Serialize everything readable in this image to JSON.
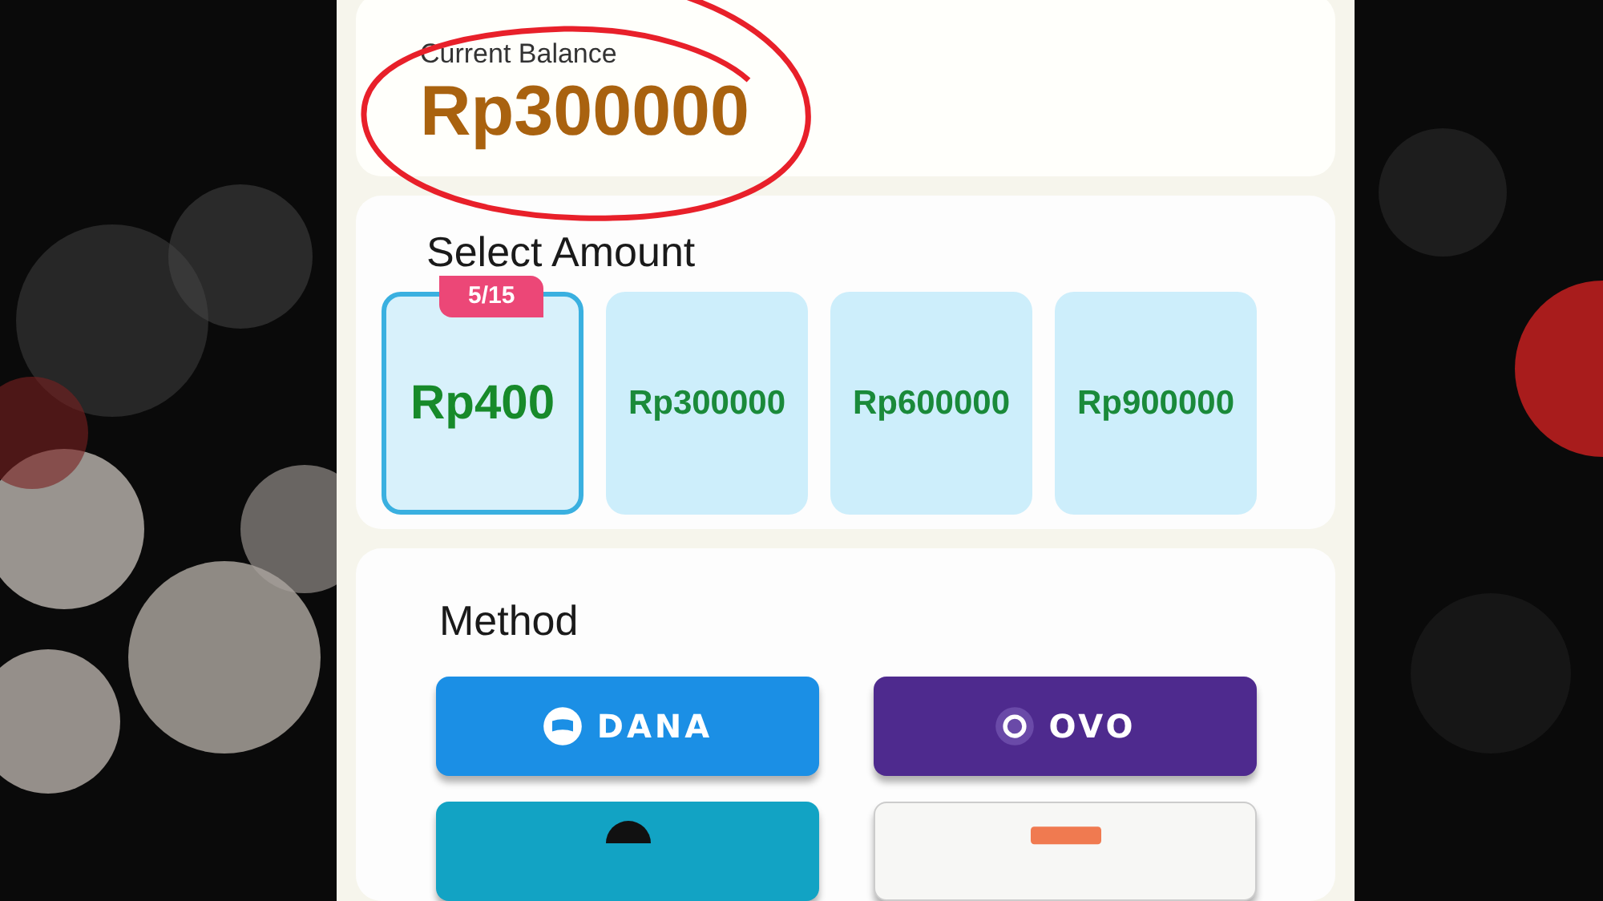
{
  "balance": {
    "label": "Current Balance",
    "amount": "Rp300000",
    "circled": true
  },
  "amounts": {
    "title": "Select Amount",
    "items": [
      {
        "label": "Rp400",
        "selected": true,
        "badge": "5/15"
      },
      {
        "label": "Rp300000",
        "selected": false
      },
      {
        "label": "Rp600000",
        "selected": false
      },
      {
        "label": "Rp900000",
        "selected": false
      }
    ]
  },
  "methods": {
    "title": "Method",
    "items": [
      {
        "kind": "dana",
        "label": "DANA",
        "color": "#1b8fe5"
      },
      {
        "kind": "ovo",
        "label": "OVO",
        "color": "#4e2a8e"
      },
      {
        "kind": "teal",
        "color": "#12a3c4"
      },
      {
        "kind": "light",
        "color": "#f7f7f5"
      }
    ]
  }
}
